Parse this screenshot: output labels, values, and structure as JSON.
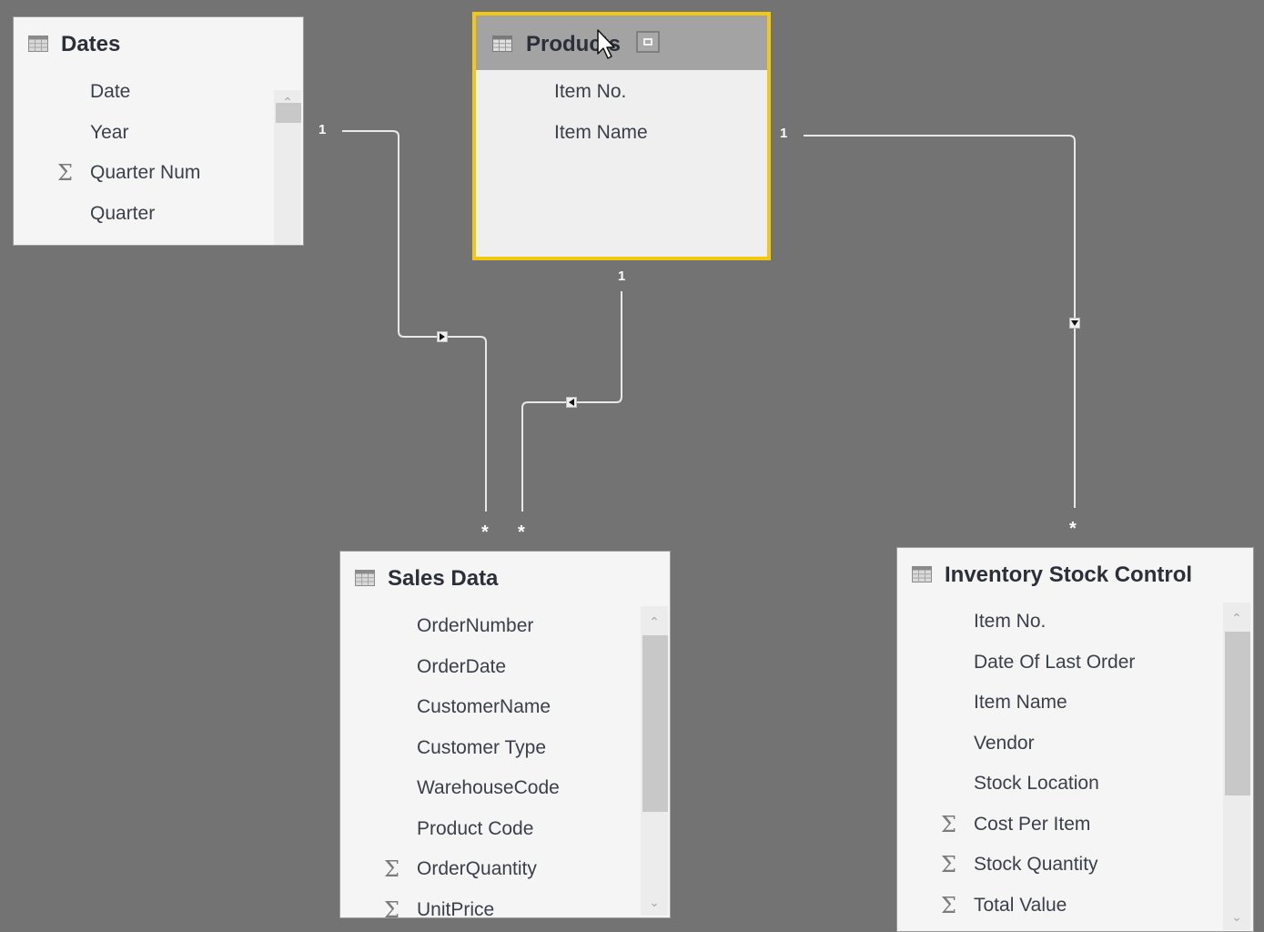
{
  "diagram": {
    "tables": [
      {
        "id": "dates",
        "title": "Dates",
        "icon": "table-icon",
        "selected": false,
        "fields": [
          {
            "name": "Date",
            "aggregate": false
          },
          {
            "name": "Year",
            "aggregate": false
          },
          {
            "name": "Quarter Num",
            "aggregate": true
          },
          {
            "name": "Quarter",
            "aggregate": false
          }
        ]
      },
      {
        "id": "products",
        "title": "Products",
        "icon": "table-icon",
        "selected": true,
        "highlight_color": "#f2c811",
        "fields": [
          {
            "name": "Item No.",
            "aggregate": false
          },
          {
            "name": "Item Name",
            "aggregate": false
          }
        ]
      },
      {
        "id": "sales",
        "title": "Sales Data",
        "icon": "table-icon",
        "selected": false,
        "fields": [
          {
            "name": "OrderNumber",
            "aggregate": false
          },
          {
            "name": "OrderDate",
            "aggregate": false
          },
          {
            "name": "CustomerName",
            "aggregate": false
          },
          {
            "name": "Customer Type",
            "aggregate": false
          },
          {
            "name": "WarehouseCode",
            "aggregate": false
          },
          {
            "name": "Product Code",
            "aggregate": false
          },
          {
            "name": "OrderQuantity",
            "aggregate": true
          },
          {
            "name": "UnitPrice",
            "aggregate": true
          }
        ]
      },
      {
        "id": "inventory",
        "title": "Inventory Stock Control",
        "icon": "table-icon",
        "selected": false,
        "fields": [
          {
            "name": "Item No.",
            "aggregate": false
          },
          {
            "name": "Date Of Last Order",
            "aggregate": false
          },
          {
            "name": "Item Name",
            "aggregate": false
          },
          {
            "name": "Vendor",
            "aggregate": false
          },
          {
            "name": "Stock Location",
            "aggregate": false
          },
          {
            "name": "Cost Per Item",
            "aggregate": true
          },
          {
            "name": "Stock Quantity",
            "aggregate": true
          },
          {
            "name": "Total Value",
            "aggregate": true
          }
        ]
      }
    ],
    "relationships": [
      {
        "from": "dates",
        "to": "sales",
        "from_cardinality": "1",
        "to_cardinality": "*",
        "filter_direction": "right"
      },
      {
        "from": "products",
        "to": "sales",
        "from_cardinality": "1",
        "to_cardinality": "*",
        "filter_direction": "left"
      },
      {
        "from": "products",
        "to": "inventory",
        "from_cardinality": "1",
        "to_cardinality": "*",
        "filter_direction": "down"
      }
    ],
    "colors": {
      "canvas": "#737373",
      "selection": "#f2c811",
      "connector": "#e8e8e8"
    }
  },
  "labels": {
    "one": "1",
    "many": "*",
    "sigma": "Σ",
    "scroll_up": "⌃",
    "scroll_down": "⌄"
  }
}
